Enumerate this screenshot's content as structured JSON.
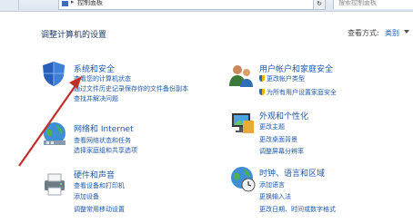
{
  "window": {
    "address_path": "控制面板",
    "search_placeholder": "搜索控制面板"
  },
  "header": {
    "title": "调整计算机的设置",
    "view_by_label": "查看方式:",
    "view_by_value": "类别"
  },
  "categories": [
    {
      "title": "系统和安全",
      "icon": "shield-icon",
      "links": [
        "查看您的计算机状态",
        "通过文件历史记录保存你的文件备份副本",
        "查找并解决问题"
      ]
    },
    {
      "title": "网络和 Internet",
      "icon": "network-icon",
      "links": [
        "查看网络状态和任务",
        "选择家庭组和共享选项"
      ]
    },
    {
      "title": "硬件和声音",
      "icon": "printer-icon",
      "links": [
        "查看设备和打印机",
        "添加设备",
        "调整常用移动设置"
      ]
    },
    {
      "title": "用户帐户和家庭安全",
      "icon": "users-icon",
      "links": [
        "更改帐户类型",
        "为所有用户设置家庭安全"
      ]
    },
    {
      "title": "外观和个性化",
      "icon": "display-icon",
      "links": [
        "更改主题",
        "更改桌面背景",
        "调整屏幕分辨率"
      ]
    },
    {
      "title": "时钟、语言和区域",
      "icon": "globe-clock-icon",
      "links": [
        "添加语言",
        "更换输入法",
        "更改日期、时间或数字格式"
      ]
    }
  ],
  "colors": {
    "link": "#1e57a8",
    "title": "#1f3b64",
    "arrow": "#c0302a"
  }
}
